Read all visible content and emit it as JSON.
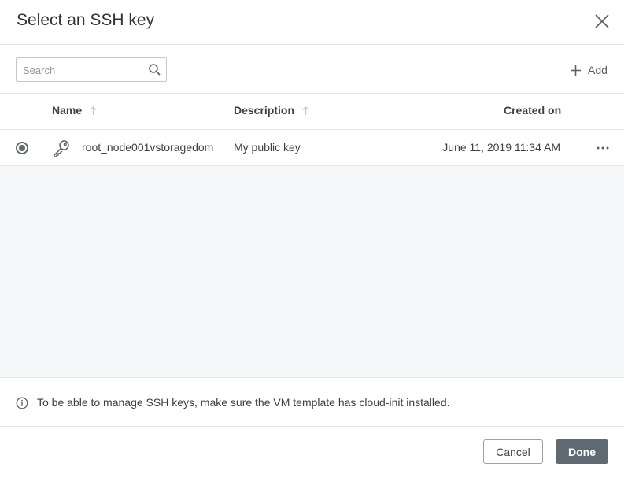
{
  "dialog": {
    "title": "Select an SSH key"
  },
  "toolbar": {
    "search_placeholder": "Search",
    "add_label": "Add"
  },
  "table": {
    "columns": [
      {
        "label": "Name",
        "sortable": true
      },
      {
        "label": "Description",
        "sortable": true
      },
      {
        "label": "Created on",
        "sortable": false
      }
    ],
    "rows": [
      {
        "selected": true,
        "name": "root_node001vstoragedom",
        "description": "My public key",
        "created_on": "June 11, 2019 11:34 AM"
      }
    ]
  },
  "info": {
    "text": "To be able to manage SSH keys, make sure the VM template has cloud-init installed."
  },
  "footer": {
    "cancel_label": "Cancel",
    "done_label": "Done"
  },
  "colors": {
    "primary_button": "#5f6a72",
    "border": "#e3e6e8",
    "empty_area": "#f6f7f8"
  }
}
